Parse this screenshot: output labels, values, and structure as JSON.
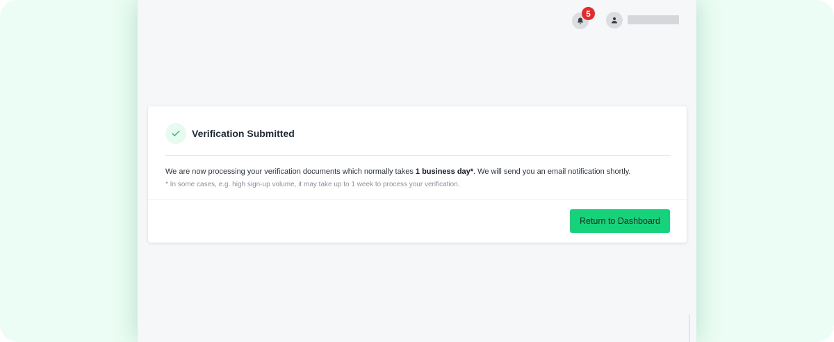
{
  "header": {
    "notifications_count": "5",
    "bell_icon": "bell-icon",
    "user_icon": "user-icon"
  },
  "card": {
    "title": "Verification Submitted",
    "body_before": "We are now processing your verification documents which normally takes ",
    "body_bold": "1 business day*",
    "body_after": ". We will send you an email notification shortly.",
    "note": "* In some cases, e.g. high sign-up volume, it may take up to 1 week to process your verification.",
    "button_label": "Return to Dashboard"
  },
  "colors": {
    "accent": "#16d27a",
    "check": "#2fc46a",
    "badge": "#e62a2a",
    "outer_bg": "#ebfdf4"
  }
}
